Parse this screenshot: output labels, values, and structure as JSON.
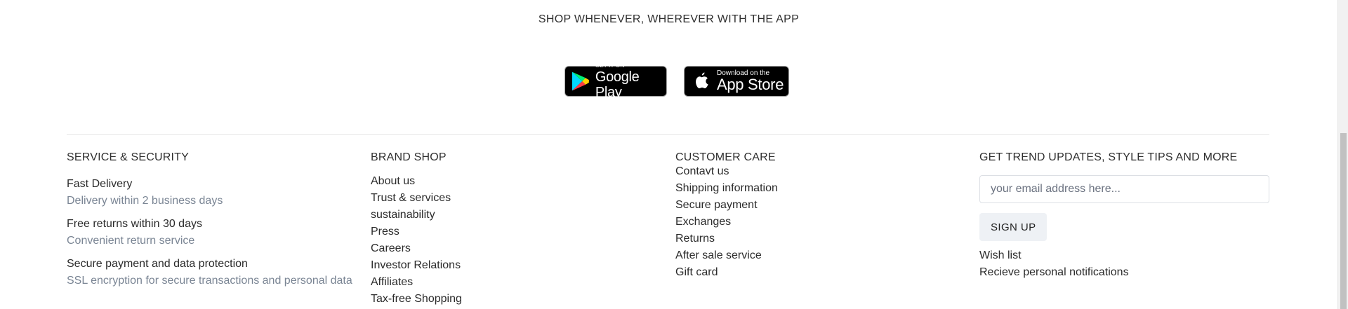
{
  "app_promo": {
    "heading": "SHOP WHENEVER, WHEREVER WITH THE APP",
    "google_play": {
      "small": "GET IT ON",
      "big": "Google Play"
    },
    "app_store": {
      "small": "Download on the",
      "big": "App Store"
    }
  },
  "service_security": {
    "title": "SERVICE & SECURITY",
    "items": [
      {
        "title": "Fast Delivery",
        "subtitle": "Delivery within 2 business days"
      },
      {
        "title": "Free returns within 30 days",
        "subtitle": "Convenient return service"
      },
      {
        "title": "Secure payment and data protection",
        "subtitle": "SSL encryption for secure transactions and personal data"
      }
    ]
  },
  "brand_shop": {
    "title": "BRAND SHOP",
    "links": [
      "About us",
      "Trust & services",
      "sustainability",
      "Press",
      "Careers",
      "Investor Relations",
      "Affiliates",
      "Tax-free Shopping"
    ]
  },
  "customer_care": {
    "title": "CUSTOMER CARE",
    "links": [
      "Contavt us",
      "Shipping information",
      "Secure payment",
      "Exchanges",
      "Returns",
      "After sale service",
      "Gift card"
    ]
  },
  "newsletter": {
    "title": "GET TREND UPDATES, STYLE TIPS AND MORE",
    "email_placeholder": "your email address here...",
    "email_value": "",
    "signup_label": "SIGN UP",
    "links": [
      "Wish list",
      "Recieve personal notifications"
    ]
  },
  "colors": {
    "subtext": "#7a8594",
    "divider": "#e6e6e6",
    "button_bg": "#eef1f5"
  }
}
